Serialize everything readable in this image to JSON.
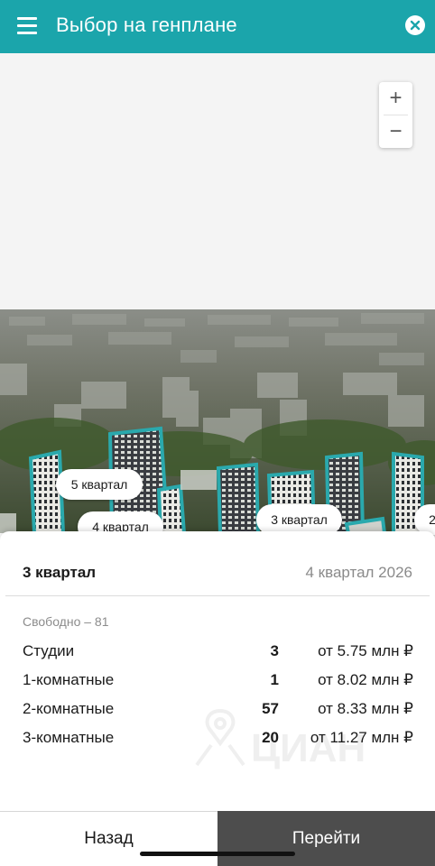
{
  "header": {
    "title": "Выбор на генплане",
    "bg_color": "#1ba5ab"
  },
  "map": {
    "zoom_in_label": "+",
    "zoom_out_label": "−"
  },
  "photo": {
    "pins": [
      {
        "label": "5 квартал"
      },
      {
        "label": "4 квартал"
      },
      {
        "label": "3 квартал"
      },
      {
        "label": "2"
      }
    ],
    "outline_color": "#2aa9ad"
  },
  "sheet": {
    "name": "3 квартал",
    "date": "4 квартал 2026",
    "free_label": "Свободно – 81",
    "rows": [
      {
        "type": "Студии",
        "count": "3",
        "price": "от 5.75 млн ₽"
      },
      {
        "type": "1-комнатные",
        "count": "1",
        "price": "от 8.02 млн ₽"
      },
      {
        "type": "2-комнатные",
        "count": "57",
        "price": "от 8.33 млн ₽"
      },
      {
        "type": "3-комнатные",
        "count": "20",
        "price": "от 11.27 млн ₽"
      }
    ],
    "watermark_text": "ЦИАН"
  },
  "footer": {
    "back_label": "Назад",
    "go_label": "Перейти",
    "go_color": "#4d4d4d"
  }
}
